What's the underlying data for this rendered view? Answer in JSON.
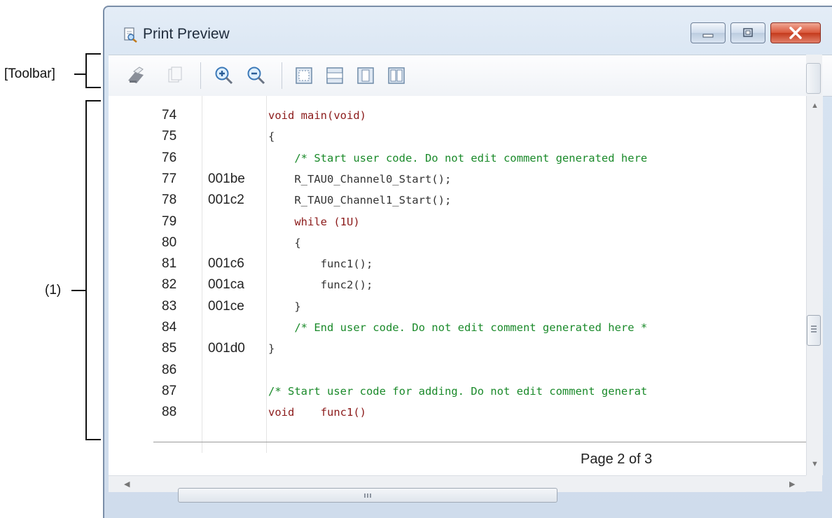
{
  "annotations": {
    "toolbar_label": "[Toolbar]",
    "area_label": "(1)"
  },
  "window": {
    "title": "Print Preview"
  },
  "toolbar": {
    "buttons": [
      {
        "icon": "print-icon"
      },
      {
        "icon": "copy-icon"
      },
      {
        "icon": "zoom-in-icon"
      },
      {
        "icon": "zoom-out-icon"
      },
      {
        "icon": "actual-size-icon"
      },
      {
        "icon": "fit-width-icon"
      },
      {
        "icon": "one-page-icon"
      },
      {
        "icon": "two-pages-icon"
      }
    ]
  },
  "preview": {
    "rows": [
      {
        "line": "74",
        "address": "",
        "code": "void main(void)"
      },
      {
        "line": "75",
        "address": "",
        "code": "{"
      },
      {
        "line": "76",
        "address": "",
        "code": "    /* Start user code. Do not edit comment generated here"
      },
      {
        "line": "77",
        "address": "001be",
        "code": "    R_TAU0_Channel0_Start();"
      },
      {
        "line": "78",
        "address": "001c2",
        "code": "    R_TAU0_Channel1_Start();"
      },
      {
        "line": "79",
        "address": "",
        "code": "    while (1U)"
      },
      {
        "line": "80",
        "address": "",
        "code": "    {"
      },
      {
        "line": "81",
        "address": "001c6",
        "code": "        func1();"
      },
      {
        "line": "82",
        "address": "001ca",
        "code": "        func2();"
      },
      {
        "line": "83",
        "address": "001ce",
        "code": "    }"
      },
      {
        "line": "84",
        "address": "",
        "code": "    /* End user code. Do not edit comment generated here *"
      },
      {
        "line": "85",
        "address": "001d0",
        "code": "}"
      },
      {
        "line": "86",
        "address": "",
        "code": ""
      },
      {
        "line": "87",
        "address": "",
        "code": "/* Start user code for adding. Do not edit comment generat"
      },
      {
        "line": "88",
        "address": "",
        "code": "void    func1()"
      }
    ],
    "page_label": "Page 2 of 3"
  },
  "colors": {
    "keyword": "#8b1a1a",
    "comment": "#1a8a2a",
    "text": "#333333"
  }
}
